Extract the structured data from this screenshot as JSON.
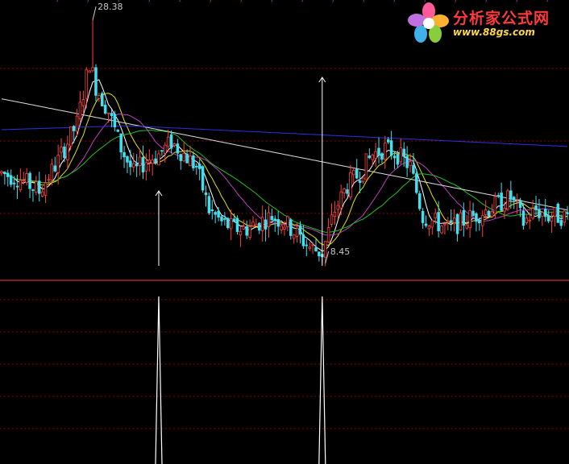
{
  "colors": {
    "background": "#000000",
    "grid": "#8b0000",
    "divider": "#c83232",
    "candle_up": "#ff4040",
    "candle_down": "#40e0f0",
    "ma_white": "#ffffff",
    "ma_yellow": "#e6e600",
    "ma_magenta": "#c040c0",
    "ma_green": "#20c020",
    "ma_long_white": "#dcdcdc",
    "ma_blue": "#3030e0",
    "signal": "#ffffff",
    "price_label": "#c8c8c8"
  },
  "watermark": {
    "title": "分析家公式网",
    "url": "www.88gs.com"
  },
  "chart_data": [
    {
      "type": "candlestick",
      "panel": "price",
      "title": "",
      "xlabel": "",
      "ylabel": "",
      "ylim": [
        7.5,
        30
      ],
      "grid": "horizontal dashed",
      "annotations": [
        {
          "text": "28.38",
          "x": 29,
          "y": 28.38,
          "kind": "high"
        },
        {
          "text": "8.45",
          "x": 103,
          "y": 8.45,
          "kind": "low"
        }
      ],
      "signal_arrows": [
        50,
        102
      ],
      "candles": [],
      "series": [
        {
          "name": "",
          "color": "#ffffff"
        },
        {
          "name": "",
          "color": "#e6e600"
        },
        {
          "name": "",
          "color": "#c040c0"
        },
        {
          "name": "",
          "color": "#20c020"
        },
        {
          "name": "",
          "color": "#dcdcdc"
        },
        {
          "name": "",
          "color": "#3030e0"
        }
      ]
    },
    {
      "type": "line",
      "panel": "signal",
      "title": "",
      "ylim": [
        0,
        1
      ],
      "signal_indices": [
        50,
        102
      ],
      "values_desc": "spikes to 1 at signal indices, 0 elsewhere"
    }
  ]
}
